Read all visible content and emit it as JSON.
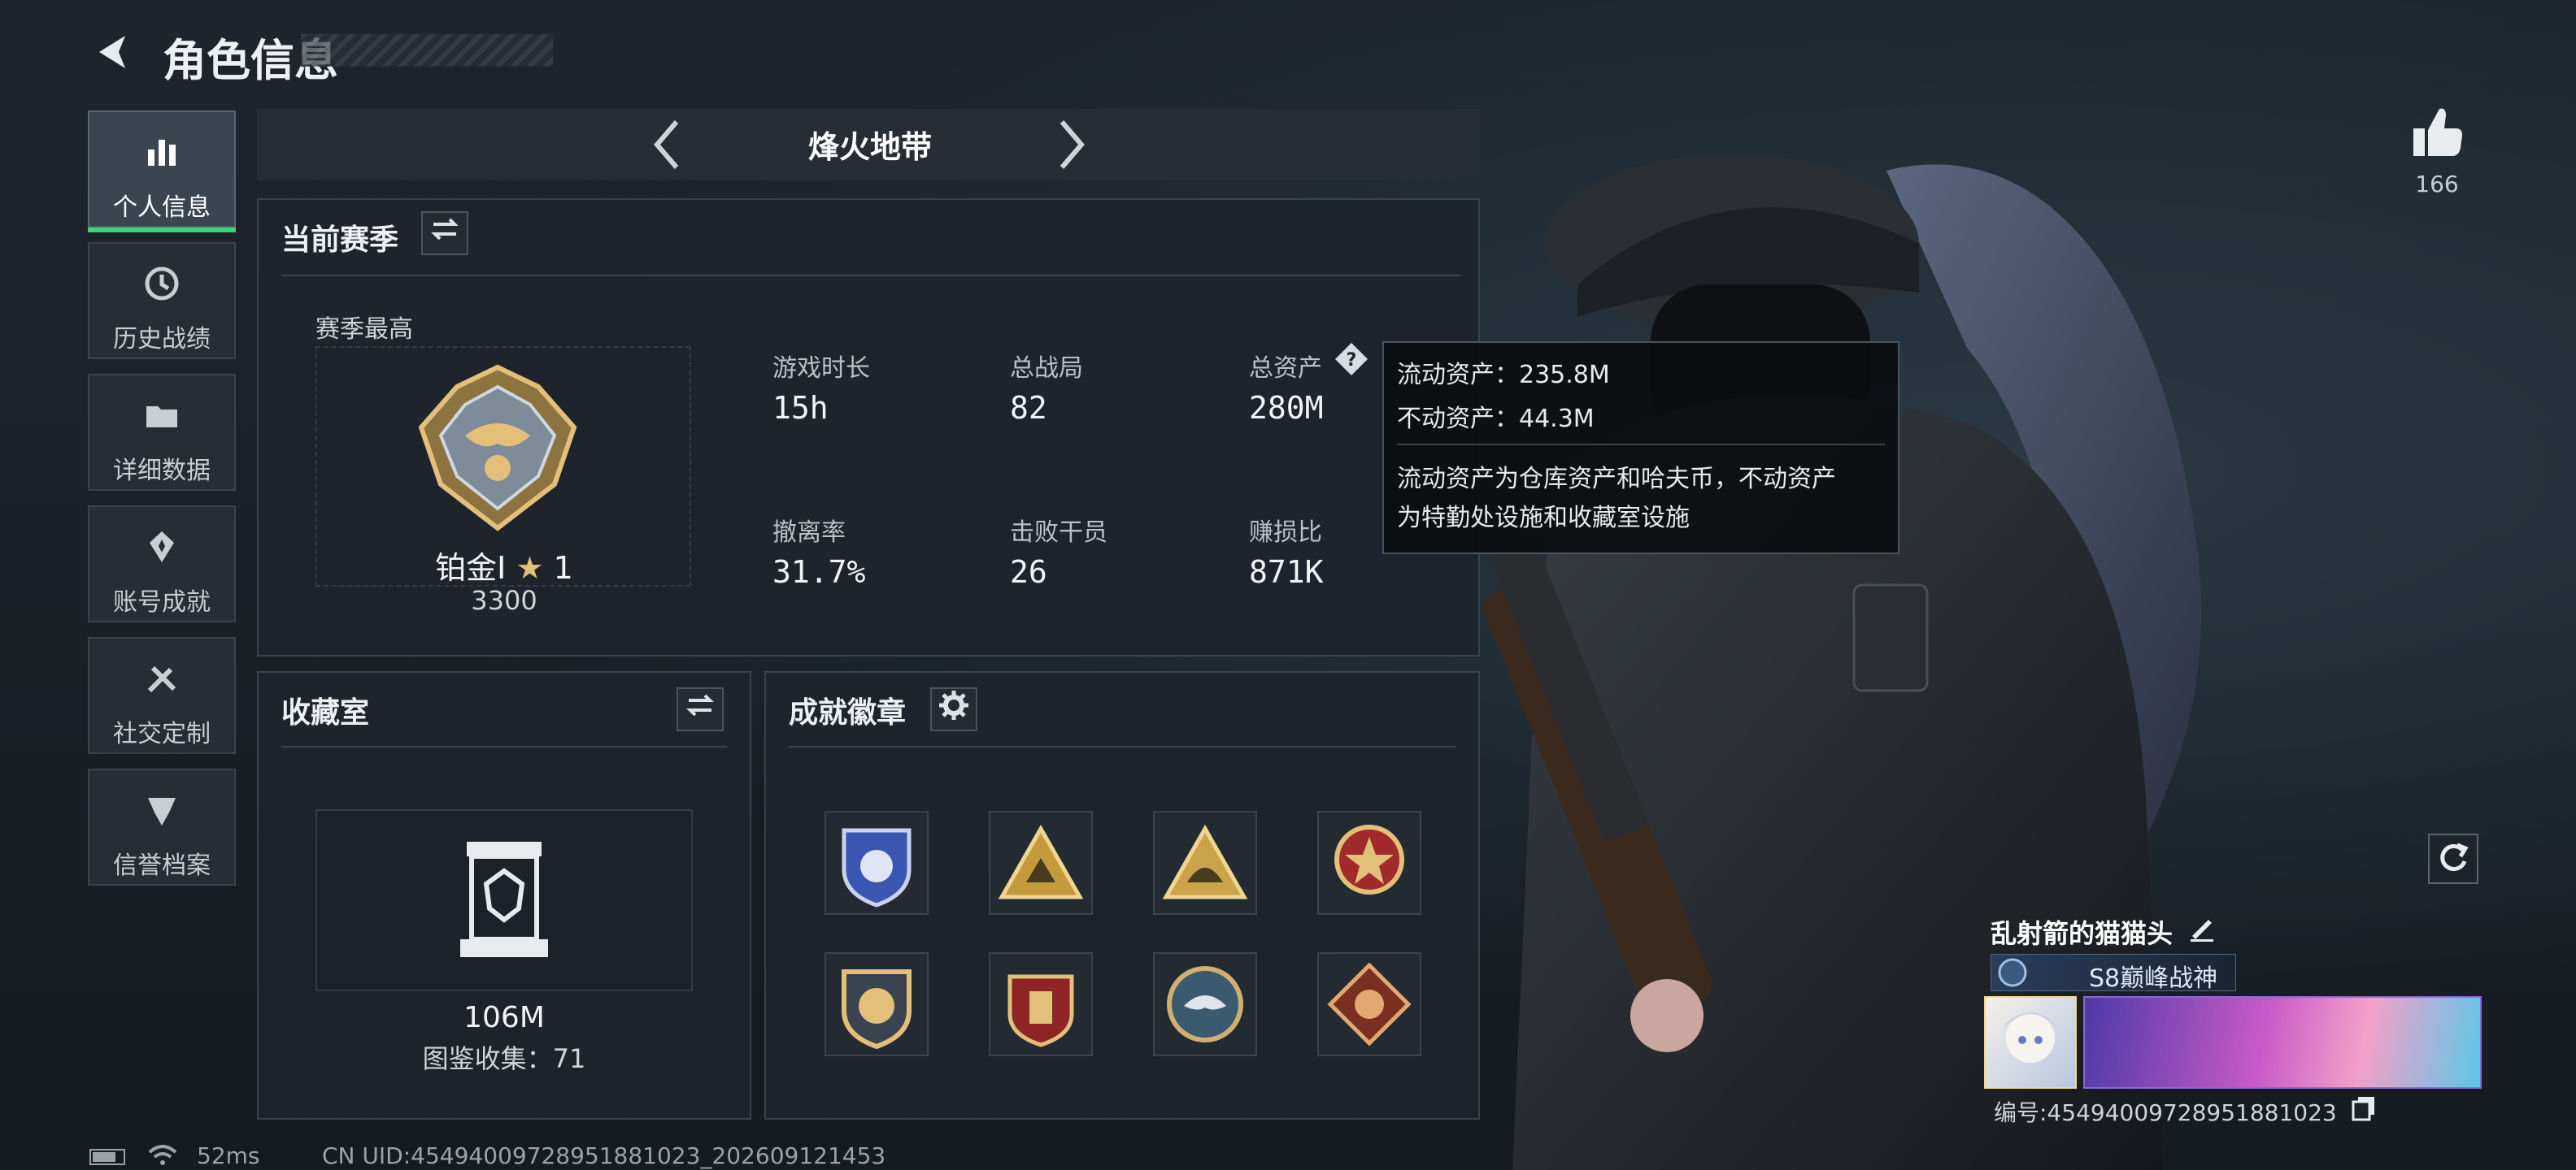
{
  "header": {
    "title": "角色信息"
  },
  "nav": {
    "items": [
      {
        "label": "个人信息",
        "icon": "bar-chart-icon",
        "active": true
      },
      {
        "label": "历史战绩",
        "icon": "history-clock-icon"
      },
      {
        "label": "详细数据",
        "icon": "folder-icon"
      },
      {
        "label": "账号成就",
        "icon": "achievement-icon"
      },
      {
        "label": "社交定制",
        "icon": "tools-icon"
      },
      {
        "label": "信誉档案",
        "icon": "credit-shield-icon"
      }
    ]
  },
  "mode_selector": {
    "label": "烽火地带"
  },
  "season": {
    "title": "当前赛季",
    "best_label": "赛季最高",
    "rank_name": "铂金Ⅰ",
    "rank_stars": "1",
    "rank_points": "3300",
    "stats": [
      {
        "label": "游戏时长",
        "value": "15h"
      },
      {
        "label": "总战局",
        "value": "82"
      },
      {
        "label": "总资产",
        "value": "280M"
      },
      {
        "label": "撤离率",
        "value": "31.7%"
      },
      {
        "label": "击败干员",
        "value": "26"
      },
      {
        "label": "赚损比",
        "value": "871K"
      }
    ]
  },
  "tooltip": {
    "liquid": "流动资产：235.8M",
    "fixed": "不动资产：44.3M",
    "desc_line1": "流动资产为仓库资产和哈夫币，不动资产",
    "desc_line2": "为特勤处设施和收藏室设施"
  },
  "collection": {
    "title": "收藏室",
    "value": "106M",
    "count_text": "图鉴收集：71"
  },
  "achievements": {
    "title": "成就徽章",
    "badges": [
      "blue-shield-badge-icon",
      "tiger-triangle-badge-icon",
      "helmet-triangle-badge-icon",
      "red-star-badge-icon",
      "gold-shield-badge-icon",
      "red-crest-badge-icon",
      "eagle-coin-badge-icon",
      "dragon-diamond-badge-icon"
    ]
  },
  "profile": {
    "likes": "166",
    "player_name": "乱射箭的猫猫头",
    "title_badge": "S8巅峰战神",
    "id_text": "编号:454940097289518810​23"
  },
  "footer": {
    "ping": "52ms",
    "uid": "CN UID:454940097289518810​23_202609121453"
  },
  "colors": {
    "accent_green": "#3ed47c",
    "panel_bg": "#1e242c",
    "gold": "#d4a74a"
  }
}
